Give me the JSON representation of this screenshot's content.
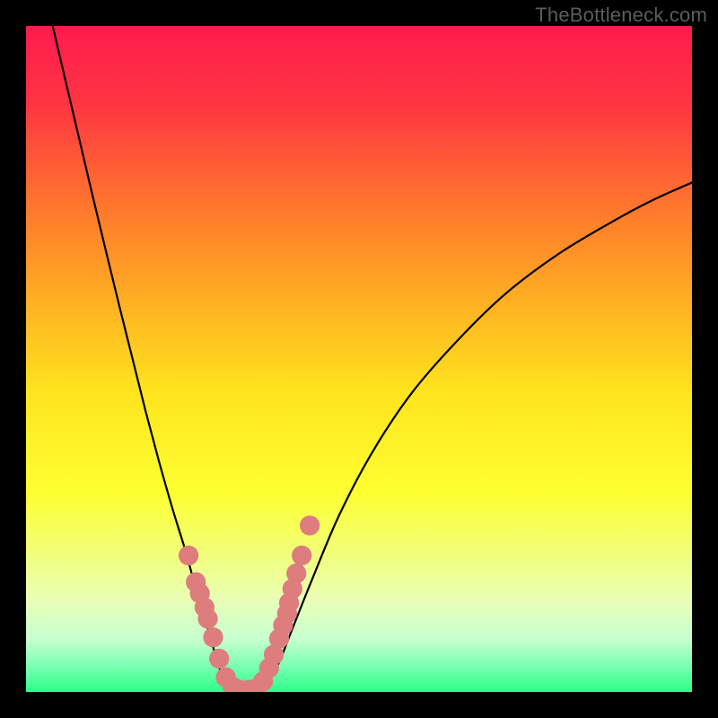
{
  "watermark": "TheBottleneck.com",
  "chart_data": {
    "type": "line",
    "title": "",
    "xlabel": "",
    "ylabel": "",
    "xlim": [
      0,
      1
    ],
    "ylim": [
      0,
      1
    ],
    "gradient_stops": [
      {
        "offset": 0.0,
        "color": "#ff1a4e"
      },
      {
        "offset": 0.12,
        "color": "#ff3642"
      },
      {
        "offset": 0.28,
        "color": "#ff7a2c"
      },
      {
        "offset": 0.42,
        "color": "#ffb222"
      },
      {
        "offset": 0.55,
        "color": "#ffe41e"
      },
      {
        "offset": 0.7,
        "color": "#fdff30"
      },
      {
        "offset": 0.78,
        "color": "#f3ff70"
      },
      {
        "offset": 0.86,
        "color": "#eaffb5"
      },
      {
        "offset": 0.92,
        "color": "#c8ffd0"
      },
      {
        "offset": 0.96,
        "color": "#7dffb3"
      },
      {
        "offset": 1.0,
        "color": "#2bff88"
      }
    ],
    "series": [
      {
        "name": "curve-left",
        "x": [
          0.04,
          0.06,
          0.08,
          0.1,
          0.12,
          0.14,
          0.16,
          0.18,
          0.2,
          0.22,
          0.24,
          0.255,
          0.27,
          0.283,
          0.293,
          0.3
        ],
        "y": [
          1.0,
          0.915,
          0.83,
          0.745,
          0.662,
          0.58,
          0.5,
          0.42,
          0.345,
          0.275,
          0.21,
          0.155,
          0.105,
          0.06,
          0.028,
          0.008
        ]
      },
      {
        "name": "curve-bottom",
        "x": [
          0.3,
          0.32,
          0.34,
          0.36
        ],
        "y": [
          0.008,
          0.0,
          0.0,
          0.01
        ]
      },
      {
        "name": "curve-right",
        "x": [
          0.36,
          0.38,
          0.4,
          0.43,
          0.47,
          0.52,
          0.58,
          0.65,
          0.72,
          0.8,
          0.88,
          0.94,
          1.0
        ],
        "y": [
          0.01,
          0.045,
          0.095,
          0.17,
          0.265,
          0.36,
          0.45,
          0.53,
          0.598,
          0.658,
          0.706,
          0.738,
          0.765
        ]
      }
    ],
    "dots": {
      "color": "#de7d7d",
      "radius_norm": 0.015,
      "points": [
        {
          "x": 0.244,
          "y": 0.205
        },
        {
          "x": 0.255,
          "y": 0.165
        },
        {
          "x": 0.261,
          "y": 0.148
        },
        {
          "x": 0.268,
          "y": 0.127
        },
        {
          "x": 0.273,
          "y": 0.11
        },
        {
          "x": 0.281,
          "y": 0.082
        },
        {
          "x": 0.29,
          "y": 0.05
        },
        {
          "x": 0.3,
          "y": 0.022
        },
        {
          "x": 0.31,
          "y": 0.008
        },
        {
          "x": 0.322,
          "y": 0.003
        },
        {
          "x": 0.334,
          "y": 0.003
        },
        {
          "x": 0.347,
          "y": 0.006
        },
        {
          "x": 0.356,
          "y": 0.016
        },
        {
          "x": 0.365,
          "y": 0.036
        },
        {
          "x": 0.372,
          "y": 0.056
        },
        {
          "x": 0.38,
          "y": 0.08
        },
        {
          "x": 0.386,
          "y": 0.1
        },
        {
          "x": 0.392,
          "y": 0.118
        },
        {
          "x": 0.395,
          "y": 0.134
        },
        {
          "x": 0.4,
          "y": 0.155
        },
        {
          "x": 0.406,
          "y": 0.178
        },
        {
          "x": 0.414,
          "y": 0.205
        },
        {
          "x": 0.426,
          "y": 0.25
        }
      ]
    }
  }
}
